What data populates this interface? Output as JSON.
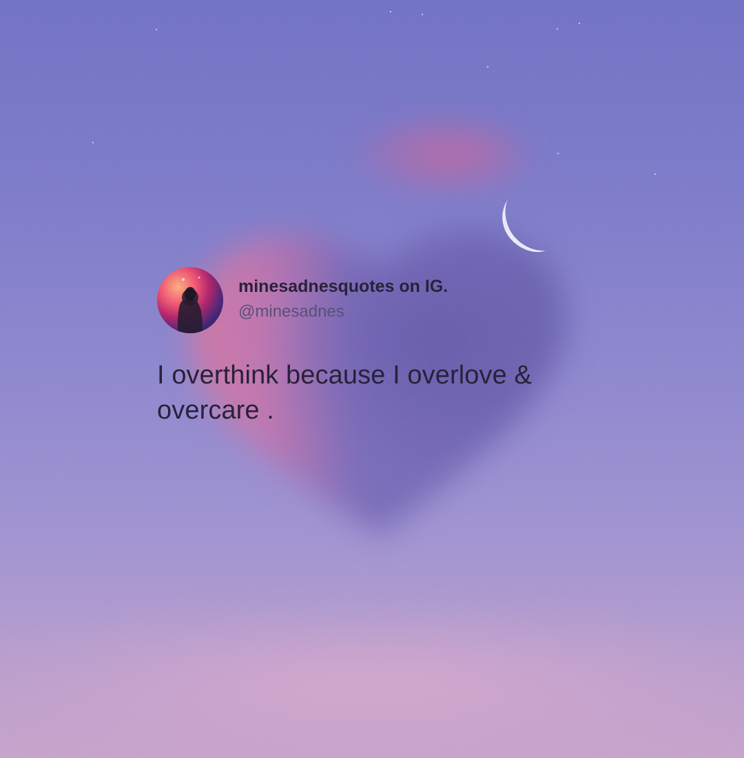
{
  "post": {
    "name": "minesadnesquotes on IG.",
    "handle": "@minesadnes",
    "quote": "I overthink because I overlove & overcare ."
  },
  "image": {
    "avatar_icon": "silhouette-person-icon",
    "moon_icon": "crescent-moon-icon",
    "heart_icon": "heart-cloud-icon"
  },
  "colors": {
    "sky_top": "#6f6fc6",
    "sky_bottom": "#c8a3cc",
    "heart_pink": "#e0739a",
    "heart_shadow": "#5f56a8",
    "text_primary": "#1f1731",
    "text_secondary": "#514a76"
  }
}
